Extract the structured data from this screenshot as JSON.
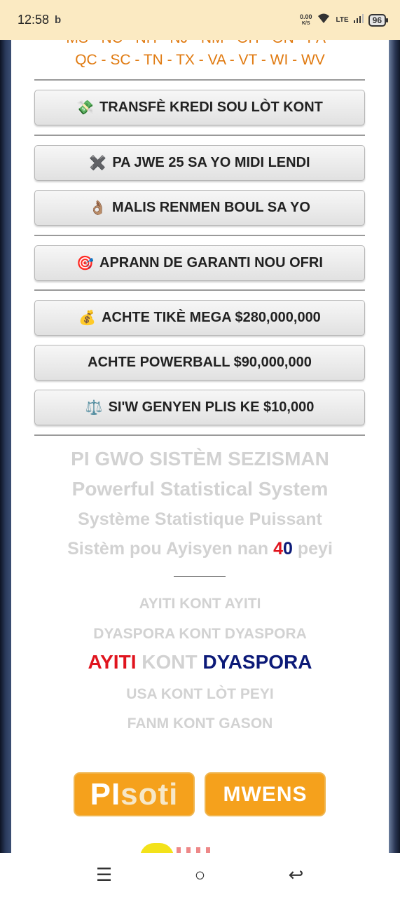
{
  "status_bar": {
    "time": "12:58",
    "notification_icon": "b",
    "net_speed_value": "0.00",
    "net_speed_unit": "K/S",
    "signal_label": "LTE",
    "battery": "96"
  },
  "states": {
    "line_cut": "MS - NC - NH - NJ - NM - OH - ON - PA -",
    "line_full": "QC - SC - TN - TX - VA - VT - WI - WV"
  },
  "buttons": {
    "transfer": {
      "icon": "💸",
      "label": "TRANSFÈ KREDI SOU LÒT KONT"
    },
    "no_play": {
      "icon": "✖️",
      "label": "PA JWE 25 SA YO MIDI LENDI"
    },
    "malis": {
      "icon": "👌🏽",
      "label": "MALIS RENMEN BOUL SA YO"
    },
    "guarantee": {
      "icon": "🎯",
      "label": "APRANN DE GARANTI NOU OFRI"
    },
    "mega": {
      "icon": "💰",
      "label": "ACHTE TIKÈ MEGA $280,000,000"
    },
    "powerball": {
      "label": "ACHTE POWERBALL $90,000,000"
    },
    "winnings": {
      "icon": "⚖️",
      "label": "SI'W GENYEN PLIS KE $10,000"
    }
  },
  "taglines": {
    "line1": "PI GWO SISTÈM SEZISMAN",
    "line2": "Powerful Statistical System",
    "line3": "Système Statistique Puissant",
    "line4_pre": "Sistèm pou Ayisyen nan ",
    "line4_digit1": "4",
    "line4_digit2": "0",
    "line4_post": " peyi"
  },
  "matchups": {
    "m1": "AYITI KONT AYITI",
    "m2": "DYASPORA KONT DYASPORA",
    "m3_a": "AYITI",
    "m3_vs": " KONT ",
    "m3_b": "DYASPORA",
    "m4": "USA KONT LÒT PEYI",
    "m5": "FANM KONT GASON"
  },
  "logos": {
    "pisoti_pi": "PI",
    "pisoti_soti": "soti",
    "mwens": "MWENS"
  },
  "nav": {
    "menu": "☰",
    "home": "○",
    "back": "↩"
  },
  "colors": {
    "accent_orange": "#e07a10",
    "logo_orange": "#f5a11c",
    "red": "#e0141e",
    "navy": "#0c1a78"
  }
}
